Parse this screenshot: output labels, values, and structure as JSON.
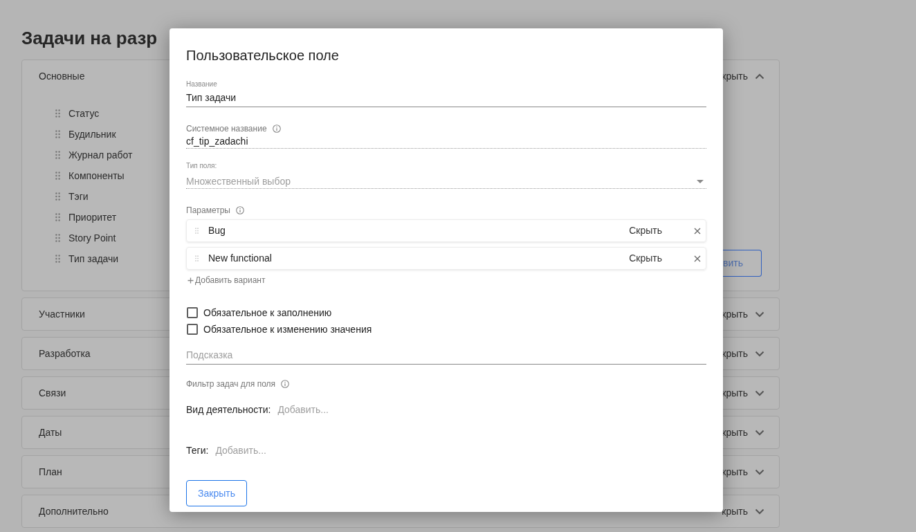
{
  "page": {
    "title": "Задачи на разр"
  },
  "sections": [
    {
      "label": "Основные",
      "expanded": true,
      "toggle": "крыть",
      "items": [
        "Статус",
        "Будильник",
        "Журнал работ",
        "Компоненты",
        "Тэги",
        "Приоритет",
        "Story Point",
        "Тип задачи"
      ],
      "button": "вить"
    },
    {
      "label": "Участники",
      "expanded": false,
      "toggle": "крыть"
    },
    {
      "label": "Разработка",
      "expanded": false,
      "toggle": "крыть"
    },
    {
      "label": "Связи",
      "expanded": false,
      "toggle": "крыть"
    },
    {
      "label": "Даты",
      "expanded": false,
      "toggle": "крыть"
    },
    {
      "label": "План",
      "expanded": false,
      "toggle": "крыть"
    },
    {
      "label": "Дополнительно",
      "expanded": false,
      "toggle": "крыть"
    }
  ],
  "dialog": {
    "title": "Пользовательское поле",
    "name_field": {
      "label": "Название",
      "value": "Тип задачи"
    },
    "system_name_field": {
      "label": "Системное название",
      "value": "cf_tip_zadachi"
    },
    "type_field": {
      "label": "Тип поля:",
      "value": "Множественный выбор",
      "disabled": true
    },
    "parameters": {
      "label": "Параметры",
      "options": [
        {
          "label": "Bug",
          "hide": "Скрыть"
        },
        {
          "label": "New functional",
          "hide": "Скрыть"
        }
      ],
      "add_option": "Добавить вариант"
    },
    "checkboxes": [
      {
        "label": "Обязательное к заполнению",
        "checked": false
      },
      {
        "label": "Обязательное к изменению значения",
        "checked": false
      }
    ],
    "hint_field": {
      "placeholder": "Подсказка"
    },
    "filter": {
      "label": "Фильтр задач для поля",
      "rows": [
        {
          "label": "Вид деятельности:",
          "placeholder": "Добавить..."
        },
        {
          "label": "Теги:",
          "placeholder": "Добавить..."
        }
      ]
    },
    "close_button": "Закрыть"
  }
}
